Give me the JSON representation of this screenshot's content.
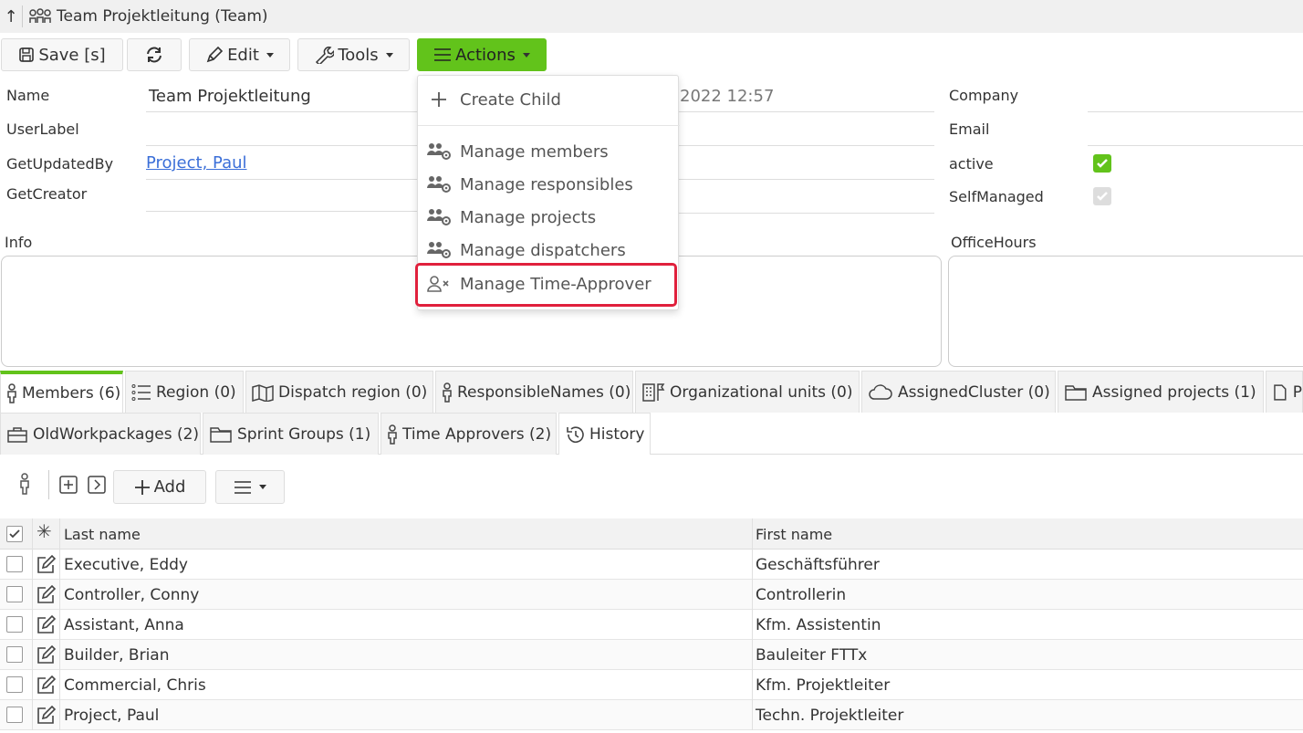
{
  "window": {
    "title": "Team Projektleitung (Team)"
  },
  "toolbar": {
    "save_label": "Save [s]",
    "edit_label": "Edit",
    "tools_label": "Tools",
    "actions_label": "Actions"
  },
  "form": {
    "name_label": "Name",
    "name_value": "Team Projektleitung",
    "userlabel_label": "UserLabel",
    "updatedby_label": "GetUpdatedBy",
    "updatedby_value": "Project, Paul",
    "creator_label": "GetCreator",
    "date_value": "2022 12:57",
    "company_label": "Company",
    "email_label": "Email",
    "active_label": "active",
    "selfmanaged_label": "SelfManaged",
    "info_label": "Info",
    "officehours_label": "OfficeHours"
  },
  "actions_menu": {
    "items": [
      {
        "label": "Create Child",
        "icon": "plus-icon"
      },
      {
        "label": "Manage members",
        "icon": "group-settings-icon"
      },
      {
        "label": "Manage responsibles",
        "icon": "group-settings-icon"
      },
      {
        "label": "Manage projects",
        "icon": "group-settings-icon"
      },
      {
        "label": "Manage dispatchers",
        "icon": "group-settings-icon"
      },
      {
        "label": "Manage Time-Approver",
        "icon": "user-x-icon"
      }
    ]
  },
  "tabs_row1": [
    "Members (6)",
    "Region (0)",
    "Dispatch region (0)",
    "ResponsibleNames (0)",
    "Organizational units (0)",
    "AssignedCluster (0)",
    "Assigned projects (1)",
    "P"
  ],
  "tabs_row2": [
    "OldWorkpackages (2)",
    "Sprint Groups (1)",
    "Time Approvers (2)",
    "History"
  ],
  "grid": {
    "add_label": "Add",
    "columns": {
      "last_name": "Last name",
      "first_name": "First name"
    },
    "rows": [
      {
        "last": "Executive, Eddy",
        "first": "Geschäftsführer"
      },
      {
        "last": "Controller, Conny",
        "first": "Controllerin"
      },
      {
        "last": "Assistant, Anna",
        "first": "Kfm. Assistentin"
      },
      {
        "last": "Builder, Brian",
        "first": "Bauleiter FTTx"
      },
      {
        "last": "Commercial, Chris",
        "first": "Kfm. Projektleiter"
      },
      {
        "last": "Project, Paul",
        "first": "Techn. Projektleiter"
      }
    ]
  },
  "colors": {
    "accent_green": "#62c31b",
    "highlight_red": "#e0203c",
    "link_blue": "#3b6fd8"
  }
}
